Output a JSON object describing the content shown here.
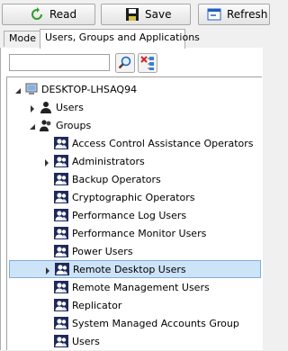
{
  "toolbar": {
    "read_label": "Read",
    "save_label": "Save",
    "refresh_label": "Refresh"
  },
  "tabs": [
    {
      "label": "Mode",
      "active": false
    },
    {
      "label": "Users, Groups and Applications",
      "active": true
    }
  ],
  "search": {
    "value": "",
    "placeholder": ""
  },
  "tree": {
    "root": "DESKTOP-LHSAQ94",
    "users": "Users",
    "groups": "Groups",
    "group_items": [
      {
        "label": "Access Control Assistance Operators",
        "expandable": false,
        "selected": false
      },
      {
        "label": "Administrators",
        "expandable": true,
        "selected": false
      },
      {
        "label": "Backup Operators",
        "expandable": false,
        "selected": false
      },
      {
        "label": "Cryptographic Operators",
        "expandable": false,
        "selected": false
      },
      {
        "label": "Performance Log Users",
        "expandable": false,
        "selected": false
      },
      {
        "label": "Performance Monitor Users",
        "expandable": false,
        "selected": false
      },
      {
        "label": "Power Users",
        "expandable": false,
        "selected": false
      },
      {
        "label": "Remote Desktop Users",
        "expandable": true,
        "selected": true
      },
      {
        "label": "Remote Management Users",
        "expandable": false,
        "selected": false
      },
      {
        "label": "Replicator",
        "expandable": false,
        "selected": false
      },
      {
        "label": "System Managed Accounts Group",
        "expandable": false,
        "selected": false
      },
      {
        "label": "Users",
        "expandable": false,
        "selected": false
      }
    ]
  },
  "colors": {
    "selection_bg": "#cde3f8",
    "selection_border": "#84acdd",
    "green_icon": "#2e9b2e",
    "blue_icon": "#1f5fbf"
  }
}
